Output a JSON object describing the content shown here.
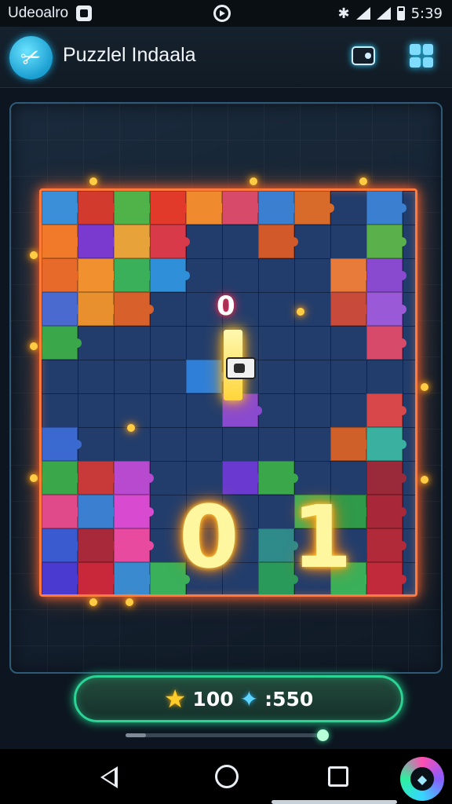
{
  "status_bar": {
    "app_label": "Udeoalro",
    "time": "5:39"
  },
  "app_bar": {
    "title": "Puzzlel Indaala",
    "icons": [
      "wallet-icon",
      "grid-icon"
    ]
  },
  "board": {
    "top_marker": "0",
    "score_left": "0",
    "score_right": "1"
  },
  "score_bar": {
    "stars": "100",
    "gems": ":550",
    "progress": 0.1
  },
  "colors": {
    "board_glow": "#ff7a3c",
    "pill_border": "#2bd494",
    "accent_yellow": "#ffcd2a"
  }
}
